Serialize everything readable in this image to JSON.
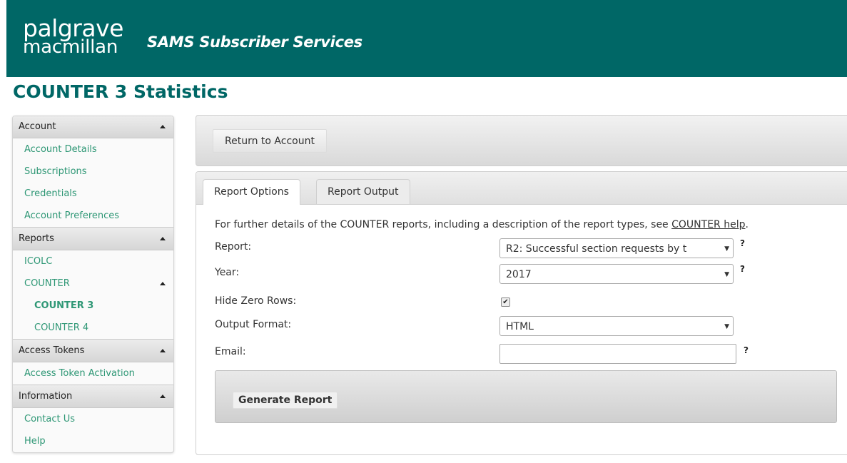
{
  "header": {
    "logo_line1": "palgrave",
    "logo_line2": "macmillan",
    "site_title": "SAMS Subscriber Services"
  },
  "page_title": "COUNTER 3 Statistics",
  "sidebar": {
    "sections": [
      {
        "label": "Account",
        "items": [
          "Account Details",
          "Subscriptions",
          "Credentials",
          "Account Preferences"
        ]
      },
      {
        "label": "Reports",
        "items": [
          "ICOLC",
          "COUNTER",
          "COUNTER 3",
          "COUNTER 4"
        ]
      },
      {
        "label": "Access Tokens",
        "items": [
          "Access Token Activation"
        ]
      },
      {
        "label": "Information",
        "items": [
          "Contact Us",
          "Help"
        ]
      }
    ]
  },
  "toolbar": {
    "return_label": "Return to Account"
  },
  "tabs": [
    {
      "label": "Report Options",
      "active": true
    },
    {
      "label": "Report Output",
      "active": false
    }
  ],
  "form": {
    "intro_text": "For further details of the COUNTER reports, including a description of the report types, see ",
    "intro_link": "COUNTER help",
    "intro_end": ".",
    "report_label": "Report:",
    "report_value": "R2: Successful section requests by t",
    "year_label": "Year:",
    "year_value": "2017",
    "hide_zero_label": "Hide Zero Rows:",
    "hide_zero_checked": true,
    "output_label": "Output Format:",
    "output_value": "HTML",
    "email_label": "Email:",
    "email_value": "",
    "help_mark": "?",
    "generate_label": "Generate Report"
  },
  "colors": {
    "header_bg": "#006766",
    "title": "#006766",
    "link_green": "#2e9775"
  }
}
